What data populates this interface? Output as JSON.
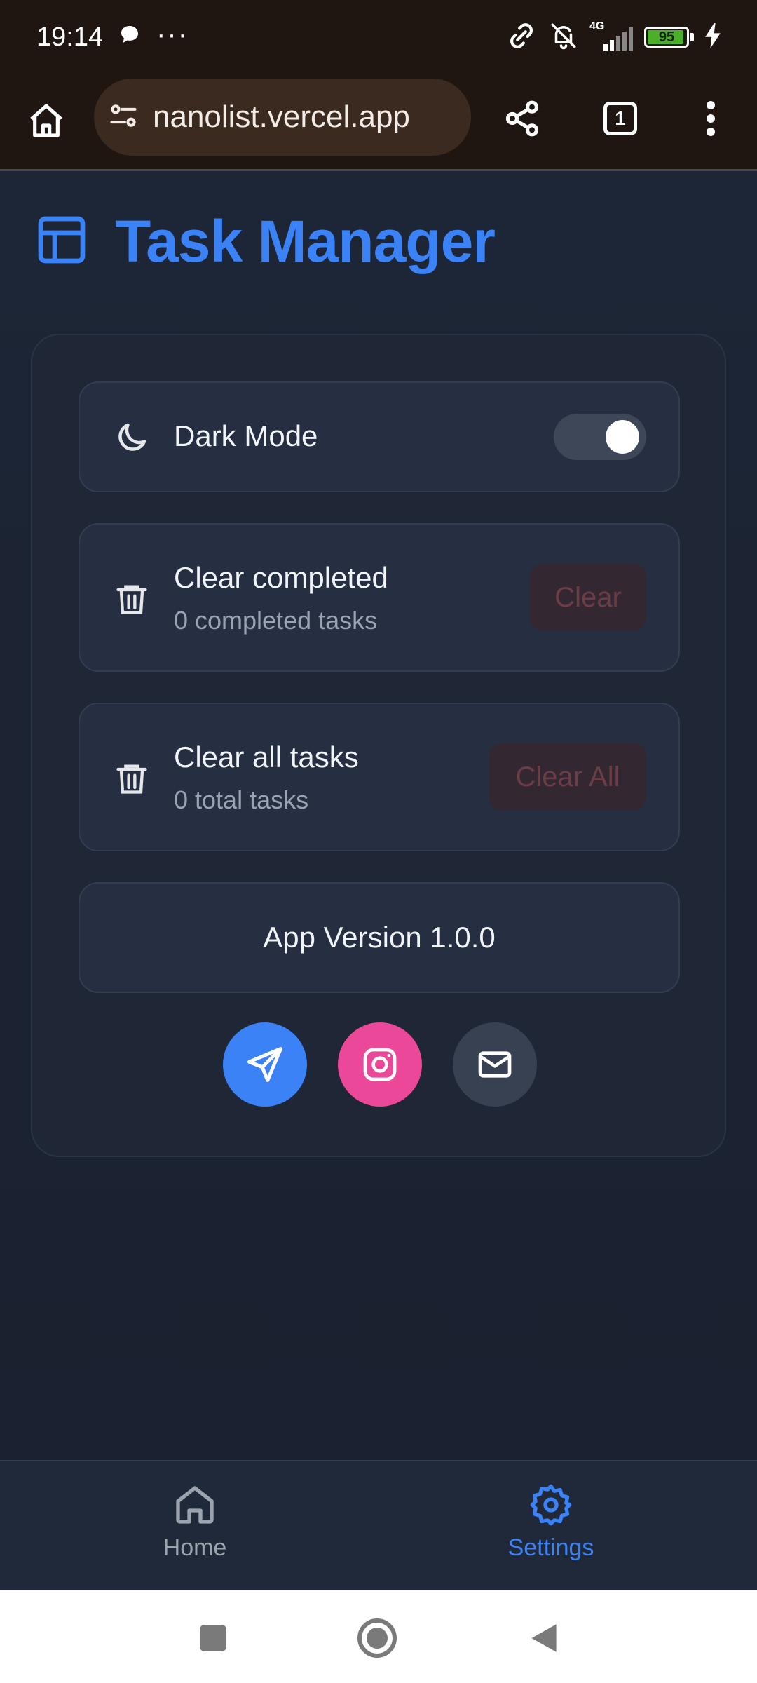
{
  "status_bar": {
    "time": "19:14",
    "more": "···",
    "network": "4G",
    "battery_level": "95",
    "battery_fraction": 0.95
  },
  "browser": {
    "url": "nanolist.vercel.app",
    "tab_count": "1"
  },
  "app": {
    "title": "Task Manager",
    "accent_color": "#3b82f6"
  },
  "settings": {
    "dark_mode": {
      "label": "Dark Mode",
      "enabled": true
    },
    "clear_completed": {
      "label": "Clear completed",
      "subtitle": "0 completed tasks",
      "button": "Clear"
    },
    "clear_all": {
      "label": "Clear all tasks",
      "subtitle": "0 total tasks",
      "button": "Clear All"
    },
    "version": "App Version 1.0.0"
  },
  "socials": [
    {
      "icon": "send-icon",
      "color": "#3b82f6"
    },
    {
      "icon": "instagram-icon",
      "color": "#ec4899"
    },
    {
      "icon": "mail-icon",
      "color": "#374151"
    }
  ],
  "bottom_nav": {
    "home": "Home",
    "settings": "Settings",
    "active": "settings"
  }
}
